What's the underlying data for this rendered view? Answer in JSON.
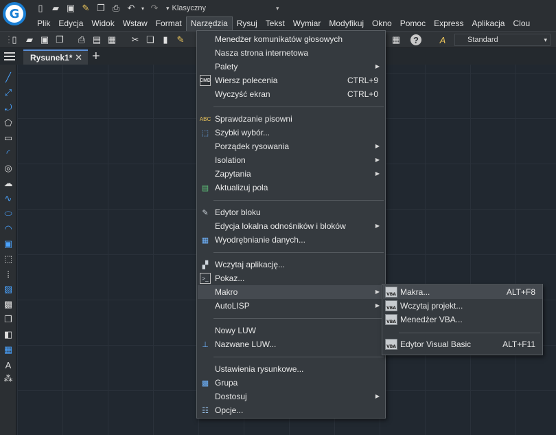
{
  "quick_access": {
    "icons": [
      "new-icon",
      "open-icon",
      "save-icon",
      "save-as-icon",
      "copy-icon",
      "print-icon",
      "undo-icon",
      "redo-icon"
    ],
    "workspace": "Klasyczny"
  },
  "menubar": {
    "items": [
      "Plik",
      "Edycja",
      "Widok",
      "Wstaw",
      "Format",
      "Narzędzia",
      "Rysuj",
      "Tekst",
      "Wymiar",
      "Modyfikuj",
      "Okno",
      "Pomoc",
      "Express",
      "Aplikacja",
      "Clou"
    ],
    "active": "Narzędzia"
  },
  "toolbar": {
    "text_style": "Standard"
  },
  "tabs": {
    "document": "Rysunek1*",
    "close": "✕",
    "new": "+"
  },
  "tools_menu": {
    "items": [
      {
        "label": "Menedżer komunikatów głosowych",
        "icon": "",
        "shortcut": "",
        "submenu": false
      },
      {
        "label": "Nasza strona internetowa",
        "icon": "",
        "shortcut": "",
        "submenu": false
      },
      {
        "label": "Palety",
        "icon": "",
        "shortcut": "",
        "submenu": true
      },
      {
        "label": "Wiersz polecenia",
        "icon": "cmd-icon",
        "shortcut": "CTRL+9",
        "submenu": false
      },
      {
        "label": "Wyczyść ekran",
        "icon": "",
        "shortcut": "CTRL+0",
        "submenu": false
      },
      {
        "label": "Sprawdzanie pisowni",
        "icon": "spellcheck-icon",
        "shortcut": "",
        "submenu": false
      },
      {
        "label": "Szybki wybór...",
        "icon": "quick-select-icon",
        "shortcut": "",
        "submenu": false
      },
      {
        "label": "Porządek rysowania",
        "icon": "",
        "shortcut": "",
        "submenu": true
      },
      {
        "label": "Isolation",
        "icon": "",
        "shortcut": "",
        "submenu": true
      },
      {
        "label": "Zapytania",
        "icon": "",
        "shortcut": "",
        "submenu": true
      },
      {
        "label": "Aktualizuj pola",
        "icon": "update-fields-icon",
        "shortcut": "",
        "submenu": false
      },
      {
        "label": "Edytor bloku",
        "icon": "block-editor-icon",
        "shortcut": "",
        "submenu": false
      },
      {
        "label": "Edycja lokalna odnośników i bloków",
        "icon": "",
        "shortcut": "",
        "submenu": true
      },
      {
        "label": "Wyodrębnianie danych...",
        "icon": "data-extraction-icon",
        "shortcut": "",
        "submenu": false
      },
      {
        "label": "Wczytaj aplikację...",
        "icon": "load-app-icon",
        "shortcut": "",
        "submenu": false
      },
      {
        "label": "Pokaz...",
        "icon": "script-icon",
        "shortcut": "",
        "submenu": false
      },
      {
        "label": "Makro",
        "icon": "",
        "shortcut": "",
        "submenu": true
      },
      {
        "label": "AutoLISP",
        "icon": "",
        "shortcut": "",
        "submenu": true
      },
      {
        "label": "Nowy LUW",
        "icon": "",
        "shortcut": "",
        "submenu": false
      },
      {
        "label": "Nazwane LUW...",
        "icon": "named-ucs-icon",
        "shortcut": "",
        "submenu": false
      },
      {
        "label": "Ustawienia rysunkowe...",
        "icon": "",
        "shortcut": "",
        "submenu": false
      },
      {
        "label": "Grupa",
        "icon": "group-icon",
        "shortcut": "",
        "submenu": false
      },
      {
        "label": "Dostosuj",
        "icon": "",
        "shortcut": "",
        "submenu": true
      },
      {
        "label": "Opcje...",
        "icon": "options-icon",
        "shortcut": "",
        "submenu": false
      }
    ],
    "highlighted": "Makro"
  },
  "macro_submenu": {
    "items": [
      {
        "label": "Makra...",
        "shortcut": "ALT+F8",
        "badge": "VBA"
      },
      {
        "label": "Wczytaj projekt...",
        "shortcut": "",
        "badge": "VBA"
      },
      {
        "label": "Menedżer VBA...",
        "shortcut": "",
        "badge": "VBA"
      },
      {
        "label": "Edytor Visual Basic",
        "shortcut": "ALT+F11",
        "badge": "VBA"
      }
    ],
    "highlighted": "Makra..."
  },
  "colors": {
    "canvas": "#212830",
    "menu_bg": "#353a3f",
    "highlight": "#454a50",
    "accent": "#1a7fd4",
    "tool_blue": "#4aa3ff"
  }
}
